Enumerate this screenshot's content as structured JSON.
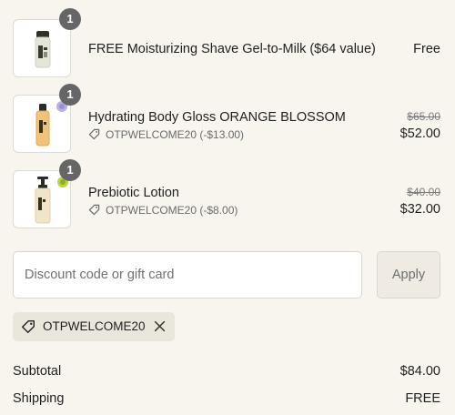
{
  "items": [
    {
      "name": "FREE Moisturizing Shave Gel-to-Milk ($64 value)",
      "quantity": "1",
      "price": "Free",
      "image_icon": "shave-gel-bottle-icon"
    },
    {
      "name": "Hydrating Body Gloss ORANGE BLOSSOM",
      "quantity": "1",
      "discount": "OTPWELCOME20 (-$13.00)",
      "original_price": "$65.00",
      "price": "$52.00",
      "image_icon": "body-gloss-bottle-icon"
    },
    {
      "name": "Prebiotic Lotion",
      "quantity": "1",
      "discount": "OTPWELCOME20 (-$8.00)",
      "original_price": "$40.00",
      "price": "$32.00",
      "image_icon": "lotion-pump-bottle-icon"
    }
  ],
  "discount_form": {
    "placeholder": "Discount code or gift card",
    "value": "",
    "apply_label": "Apply"
  },
  "applied_code": {
    "code": "OTPWELCOME20",
    "tag_icon": "tag-icon",
    "remove_icon": "close-icon"
  },
  "summary": {
    "subtotal_label": "Subtotal",
    "subtotal_value": "$84.00",
    "shipping_label": "Shipping",
    "shipping_value": "FREE"
  },
  "colors": {
    "page_background": "#f8f5ee",
    "badge": "#666666",
    "muted_text": "#6b6b6b",
    "chip_background": "#ebe6dc"
  }
}
